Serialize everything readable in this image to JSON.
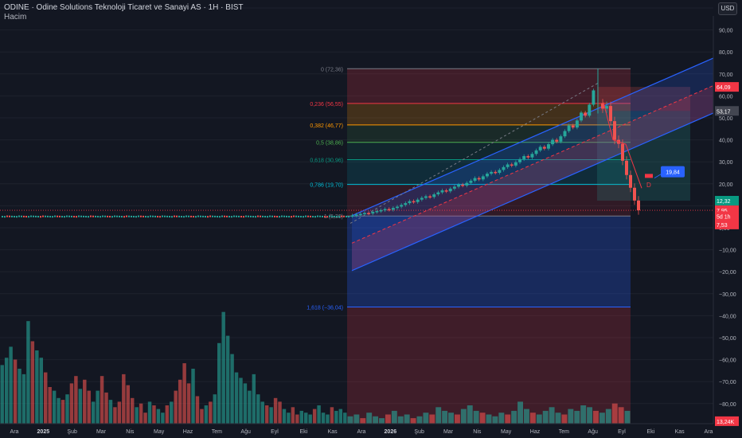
{
  "header": {
    "title": "ODINE · Odine Solutions Teknoloji Ticaret ve Sanayi AS · 1H · BIST",
    "subtitle": "Hacim",
    "currency": "USD"
  },
  "colors": {
    "background": "#131722",
    "up": "#26a69a",
    "down": "#ef5350",
    "channel": "#2962ff"
  },
  "chart_data": {
    "type": "candlestick",
    "title": "ODINE · Odine Solutions Teknoloji Ticaret ve Sanayi AS · 1H · BIST",
    "y_ticks": [
      "100,00",
      "90,00",
      "80,00",
      "70,00",
      "60,00",
      "50,00",
      "40,00",
      "30,00",
      "20,00",
      "10,00",
      "0,00",
      "−10,00",
      "−20,00",
      "−30,00",
      "−40,00",
      "−50,00",
      "−60,00",
      "−70,00",
      "−80,00"
    ],
    "ylim": [
      -85,
      105
    ],
    "x_ticks": [
      "Ara",
      "2025",
      "Şub",
      "Mar",
      "Nis",
      "May",
      "Haz",
      "Tem",
      "Ağu",
      "Eyl",
      "Eki",
      "Kas",
      "Ara",
      "2026",
      "Şub",
      "Mar",
      "Nis",
      "May",
      "Haz",
      "Tem",
      "Ağu",
      "Eyl",
      "Eki",
      "Kas",
      "Ara"
    ],
    "fibonacci": [
      {
        "label": "0 (72,36)",
        "value": 72.36,
        "color": "#787b86"
      },
      {
        "label": "0,236 (56,55)",
        "value": 56.55,
        "color": "#f23645"
      },
      {
        "label": "0,382 (46,77)",
        "value": 46.77,
        "color": "#ff9800"
      },
      {
        "label": "0,5 (38,86)",
        "value": 38.86,
        "color": "#4caf50"
      },
      {
        "label": "0,618 (30,96)",
        "value": 30.96,
        "color": "#089981"
      },
      {
        "label": "0,786 (19,70)",
        "value": 19.7,
        "color": "#00bcd4"
      },
      {
        "label": "1 (5,36)",
        "value": 5.36,
        "color": "#787b86"
      },
      {
        "label": "1,618 (−36,04)",
        "value": -36.04,
        "color": "#2962ff"
      }
    ],
    "price_labels": [
      {
        "text": "64,09",
        "value": 64.09,
        "color": "#f23645"
      },
      {
        "text": "53,17",
        "value": 53.17,
        "color": "#434651"
      },
      {
        "text": "12,32",
        "value": 12.32,
        "color": "#089981"
      },
      {
        "text": "7,95",
        "value": 7.95,
        "color": "#f23645"
      },
      {
        "text": "5d 1h",
        "value": 5.2,
        "color": "#f23645"
      },
      {
        "text": "7,53",
        "value": 1.5,
        "color": "#f23645"
      },
      {
        "text": "13,24K",
        "value": -88,
        "color": "#f23645"
      }
    ],
    "annotations": [
      {
        "text": "19,84",
        "value": 25.5
      },
      {
        "text": "D",
        "value": 19.5
      }
    ],
    "pre_series_value": 5.0,
    "trend_candles": [
      [
        5.4,
        5.6
      ],
      [
        5.6,
        6.0
      ],
      [
        6.0,
        6.3
      ],
      [
        6.3,
        6.7
      ],
      [
        6.7,
        6.5
      ],
      [
        6.5,
        7.2
      ],
      [
        7.2,
        7.6
      ],
      [
        7.6,
        8.0
      ],
      [
        8.0,
        8.5
      ],
      [
        8.5,
        8.2
      ],
      [
        8.2,
        9.0
      ],
      [
        9.0,
        9.6
      ],
      [
        9.6,
        10.4
      ],
      [
        10.4,
        11.2
      ],
      [
        11.2,
        12.1
      ],
      [
        12.1,
        11.7
      ],
      [
        11.7,
        12.8
      ],
      [
        12.8,
        13.6
      ],
      [
        13.6,
        14.3
      ],
      [
        14.3,
        14.0
      ],
      [
        14.0,
        15.2
      ],
      [
        15.2,
        16.1
      ],
      [
        16.1,
        17.0
      ],
      [
        17.0,
        16.6
      ],
      [
        16.6,
        17.8
      ],
      [
        17.8,
        18.7
      ],
      [
        18.7,
        19.6
      ],
      [
        19.6,
        19.2
      ],
      [
        19.2,
        20.4
      ],
      [
        20.4,
        21.4
      ],
      [
        21.4,
        22.6
      ],
      [
        22.6,
        22.0
      ],
      [
        22.0,
        23.4
      ],
      [
        23.4,
        24.6
      ],
      [
        24.6,
        25.4
      ],
      [
        25.4,
        25.0
      ],
      [
        25.0,
        26.3
      ],
      [
        26.3,
        27.6
      ],
      [
        27.6,
        28.8
      ],
      [
        28.8,
        28.3
      ],
      [
        28.3,
        29.8
      ],
      [
        29.8,
        31.2
      ],
      [
        31.2,
        32.6
      ],
      [
        32.6,
        32.0
      ],
      [
        32.0,
        33.6
      ],
      [
        33.6,
        35.2
      ],
      [
        35.2,
        36.8
      ],
      [
        36.8,
        36.0
      ],
      [
        36.0,
        38.0
      ],
      [
        38.0,
        40.0
      ],
      [
        40.0,
        39.2
      ],
      [
        39.2,
        41.6
      ],
      [
        41.6,
        44.0
      ],
      [
        44.0,
        46.5
      ],
      [
        46.5,
        45.6
      ],
      [
        45.6,
        48.8
      ],
      [
        48.8,
        52.4
      ],
      [
        52.4,
        51.0
      ],
      [
        51.0,
        56.0
      ],
      [
        56.0,
        62.5
      ]
    ],
    "drop_candles": [
      [
        56.6,
        54.2
      ],
      [
        54.2,
        55.4
      ],
      [
        55.4,
        48.5
      ],
      [
        48.5,
        40.0
      ],
      [
        40.0,
        38.2
      ],
      [
        38.2,
        30.5
      ],
      [
        30.5,
        24.0
      ],
      [
        24.0,
        18.2
      ],
      [
        18.2,
        12.4
      ],
      [
        12.4,
        7.95
      ]
    ],
    "volume_left": [
      {
        "v": 0.32,
        "up": true
      },
      {
        "v": 0.36,
        "up": true
      },
      {
        "v": 0.42,
        "up": true
      },
      {
        "v": 0.35,
        "up": false
      },
      {
        "v": 0.3,
        "up": true
      },
      {
        "v": 0.27,
        "up": true
      },
      {
        "v": 0.56,
        "up": true
      },
      {
        "v": 0.45,
        "up": false
      },
      {
        "v": 0.4,
        "up": true
      },
      {
        "v": 0.36,
        "up": true
      },
      {
        "v": 0.28,
        "up": false
      },
      {
        "v": 0.2,
        "up": false
      },
      {
        "v": 0.18,
        "up": true
      },
      {
        "v": 0.14,
        "up": true
      },
      {
        "v": 0.13,
        "up": false
      },
      {
        "v": 0.16,
        "up": true
      },
      {
        "v": 0.22,
        "up": false
      },
      {
        "v": 0.26,
        "up": false
      },
      {
        "v": 0.19,
        "up": true
      },
      {
        "v": 0.24,
        "up": false
      },
      {
        "v": 0.18,
        "up": false
      },
      {
        "v": 0.12,
        "up": true
      },
      {
        "v": 0.18,
        "up": true
      },
      {
        "v": 0.26,
        "up": false
      },
      {
        "v": 0.17,
        "up": false
      },
      {
        "v": 0.13,
        "up": true
      },
      {
        "v": 0.09,
        "up": false
      },
      {
        "v": 0.12,
        "up": false
      },
      {
        "v": 0.27,
        "up": false
      },
      {
        "v": 0.21,
        "up": false
      },
      {
        "v": 0.14,
        "up": false
      },
      {
        "v": 0.09,
        "up": true
      },
      {
        "v": 0.11,
        "up": false
      },
      {
        "v": 0.06,
        "up": false
      },
      {
        "v": 0.12,
        "up": true
      },
      {
        "v": 0.1,
        "up": false
      },
      {
        "v": 0.08,
        "up": true
      },
      {
        "v": 0.06,
        "up": true
      },
      {
        "v": 0.1,
        "up": false
      },
      {
        "v": 0.12,
        "up": true
      },
      {
        "v": 0.18,
        "up": false
      },
      {
        "v": 0.24,
        "up": false
      },
      {
        "v": 0.33,
        "up": false
      },
      {
        "v": 0.22,
        "up": false
      },
      {
        "v": 0.3,
        "up": true
      },
      {
        "v": 0.15,
        "up": false
      },
      {
        "v": 0.08,
        "up": false
      },
      {
        "v": 0.1,
        "up": true
      },
      {
        "v": 0.12,
        "up": false
      },
      {
        "v": 0.16,
        "up": true
      },
      {
        "v": 0.44,
        "up": true
      },
      {
        "v": 0.61,
        "up": true
      },
      {
        "v": 0.48,
        "up": true
      },
      {
        "v": 0.38,
        "up": true
      },
      {
        "v": 0.28,
        "up": true
      },
      {
        "v": 0.25,
        "up": true
      },
      {
        "v": 0.22,
        "up": true
      },
      {
        "v": 0.18,
        "up": true
      },
      {
        "v": 0.27,
        "up": true
      },
      {
        "v": 0.16,
        "up": true
      },
      {
        "v": 0.12,
        "up": true
      },
      {
        "v": 0.1,
        "up": false
      },
      {
        "v": 0.09,
        "up": true
      },
      {
        "v": 0.14,
        "up": false
      },
      {
        "v": 0.12,
        "up": false
      },
      {
        "v": 0.08,
        "up": true
      },
      {
        "v": 0.06,
        "up": true
      },
      {
        "v": 0.09,
        "up": false
      },
      {
        "v": 0.05,
        "up": false
      },
      {
        "v": 0.07,
        "up": true
      },
      {
        "v": 0.06,
        "up": true
      },
      {
        "v": 0.05,
        "up": true
      },
      {
        "v": 0.08,
        "up": false
      },
      {
        "v": 0.1,
        "up": true
      },
      {
        "v": 0.06,
        "up": true
      },
      {
        "v": 0.05,
        "up": true
      },
      {
        "v": 0.09,
        "up": false
      },
      {
        "v": 0.07,
        "up": true
      },
      {
        "v": 0.08,
        "up": true
      },
      {
        "v": 0.06,
        "up": true
      }
    ],
    "volume_right": [
      {
        "v": 0.04,
        "up": true
      },
      {
        "v": 0.05,
        "up": true
      },
      {
        "v": 0.03,
        "up": false
      },
      {
        "v": 0.06,
        "up": true
      },
      {
        "v": 0.04,
        "up": true
      },
      {
        "v": 0.03,
        "up": true
      },
      {
        "v": 0.05,
        "up": false
      },
      {
        "v": 0.07,
        "up": true
      },
      {
        "v": 0.04,
        "up": true
      },
      {
        "v": 0.05,
        "up": true
      },
      {
        "v": 0.03,
        "up": false
      },
      {
        "v": 0.04,
        "up": true
      },
      {
        "v": 0.06,
        "up": true
      },
      {
        "v": 0.05,
        "up": false
      },
      {
        "v": 0.09,
        "up": true
      },
      {
        "v": 0.07,
        "up": true
      },
      {
        "v": 0.06,
        "up": true
      },
      {
        "v": 0.05,
        "up": false
      },
      {
        "v": 0.08,
        "up": true
      },
      {
        "v": 0.1,
        "up": true
      },
      {
        "v": 0.07,
        "up": true
      },
      {
        "v": 0.06,
        "up": false
      },
      {
        "v": 0.05,
        "up": true
      },
      {
        "v": 0.04,
        "up": true
      },
      {
        "v": 0.06,
        "up": true
      },
      {
        "v": 0.05,
        "up": false
      },
      {
        "v": 0.07,
        "up": true
      },
      {
        "v": 0.12,
        "up": true
      },
      {
        "v": 0.08,
        "up": true
      },
      {
        "v": 0.06,
        "up": false
      },
      {
        "v": 0.05,
        "up": true
      },
      {
        "v": 0.07,
        "up": true
      },
      {
        "v": 0.09,
        "up": true
      },
      {
        "v": 0.06,
        "up": true
      },
      {
        "v": 0.05,
        "up": false
      },
      {
        "v": 0.08,
        "up": true
      },
      {
        "v": 0.07,
        "up": true
      },
      {
        "v": 0.1,
        "up": true
      },
      {
        "v": 0.09,
        "up": true
      },
      {
        "v": 0.07,
        "up": false
      },
      {
        "v": 0.06,
        "up": true
      },
      {
        "v": 0.08,
        "up": true
      },
      {
        "v": 0.11,
        "up": false
      },
      {
        "v": 0.09,
        "up": false
      },
      {
        "v": 0.07,
        "up": true
      }
    ]
  }
}
